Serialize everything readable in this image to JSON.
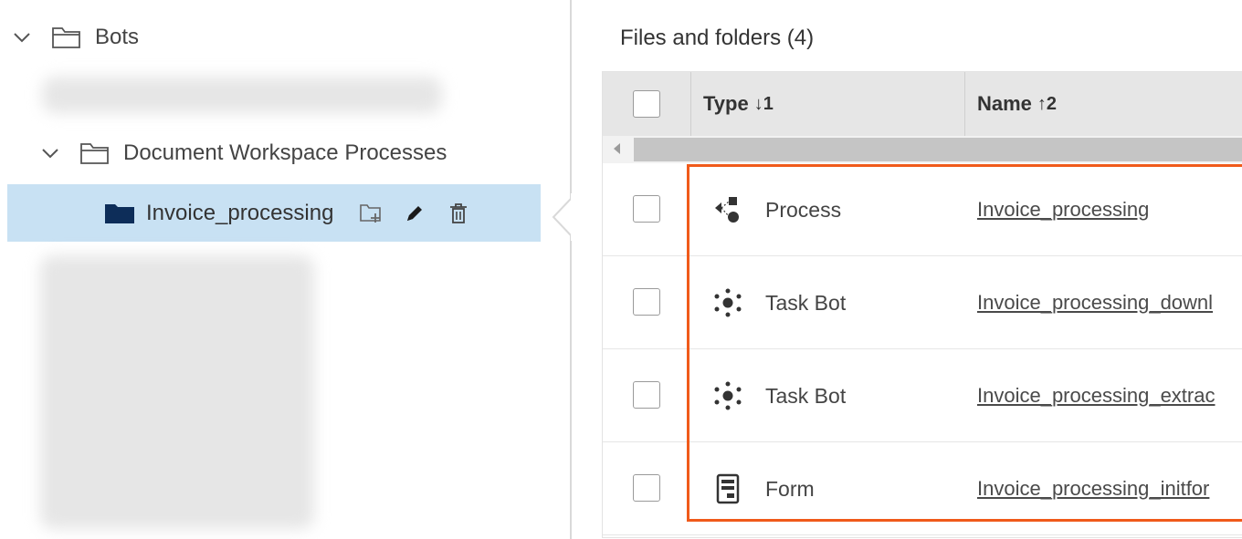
{
  "tree": {
    "root": {
      "label": "Bots",
      "expanded": true
    },
    "folder": {
      "label": "Document Workspace Processes",
      "expanded": true
    },
    "selected": {
      "label": "Invoice_processing"
    },
    "actions": [
      "new-folder-icon",
      "edit-icon",
      "delete-icon"
    ]
  },
  "files": {
    "title": "Files and folders",
    "count": "(4)",
    "columns": [
      {
        "label": "Type",
        "sort": "↓1"
      },
      {
        "label": "Name",
        "sort": "↑2"
      }
    ],
    "rows": [
      {
        "type": "Process",
        "icon": "process-icon",
        "name": "Invoice_processing"
      },
      {
        "type": "Task Bot",
        "icon": "task-bot-icon",
        "name": "Invoice_processing_downl"
      },
      {
        "type": "Task Bot",
        "icon": "task-bot-icon",
        "name": "Invoice_processing_extrac"
      },
      {
        "type": "Form",
        "icon": "form-icon",
        "name": "Invoice_processing_initfor"
      }
    ]
  },
  "colors": {
    "selection": "#c8e1f3",
    "highlight": "#f05a1a",
    "header": "#e6e6e6"
  }
}
